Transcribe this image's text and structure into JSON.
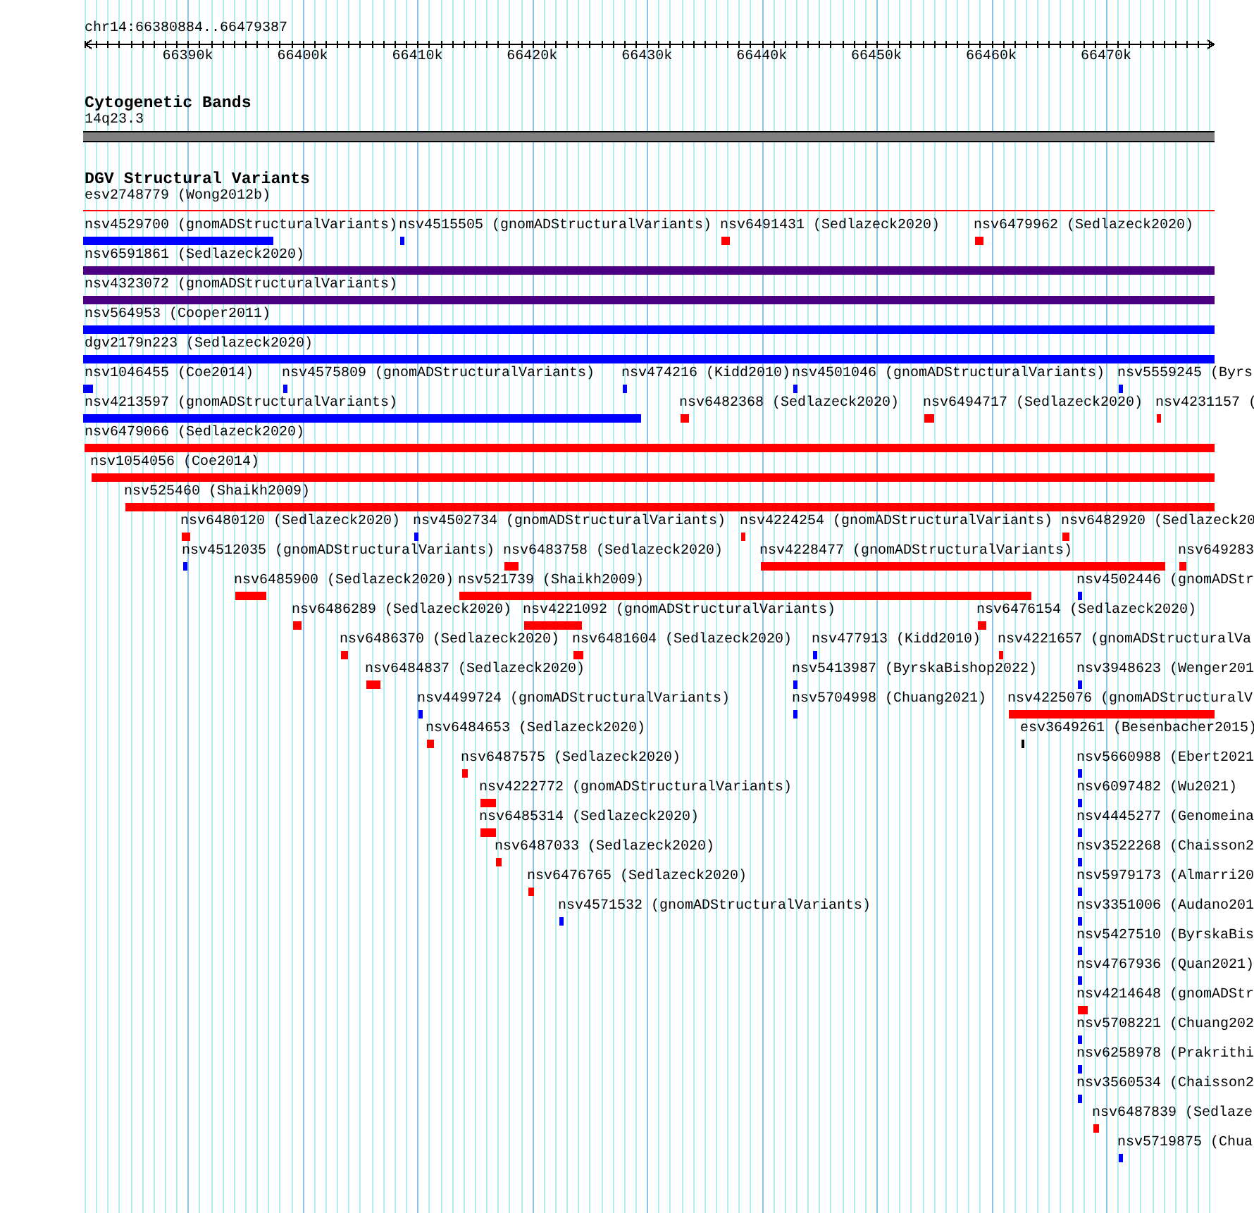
{
  "ruler": {
    "location": "chr14:66380884..66479387",
    "ticks": [
      "66390k",
      "66400k",
      "66410k",
      "66420k",
      "66430k",
      "66440k",
      "66450k",
      "66460k",
      "66470k"
    ]
  },
  "cytogenetic_bands": {
    "title": "Cytogenetic Bands",
    "band_label": "14q23.3"
  },
  "dgv_structural_variants": {
    "title": "DGV Structural Variants",
    "rows": [
      [
        {
          "label": "esv2748779 (Wong2012b)",
          "color": "#ff0000"
        }
      ],
      [
        {
          "label": "nsv4529700 (gnomADStructuralVariants)",
          "color": "#0000ff"
        },
        {
          "label": "nsv4515505 (gnomADStructuralVariants)",
          "color": "#0000ff"
        },
        {
          "label": "nsv6491431 (Sedlazeck2020)",
          "color": "#ff0000"
        },
        {
          "label": "nsv6479962 (Sedlazeck2020)",
          "color": "#ff0000"
        }
      ],
      [
        {
          "label": "nsv6591861 (Sedlazeck2020)",
          "color": "#4b0082"
        }
      ],
      [
        {
          "label": "nsv4323072 (gnomADStructuralVariants)",
          "color": "#4b0082"
        }
      ],
      [
        {
          "label": "nsv564953 (Cooper2011)",
          "color": "#0000ff"
        }
      ],
      [
        {
          "label": "dgv2179n223 (Sedlazeck2020)",
          "color": "#0000ff"
        }
      ],
      [
        {
          "label": "nsv1046455 (Coe2014)",
          "color": "#0000ff"
        },
        {
          "label": "nsv4575809 (gnomADStructuralVariants)",
          "color": "#0000ff"
        },
        {
          "label": "nsv474216 (Kidd2010)",
          "color": "#0000ff"
        },
        {
          "label": "nsv4501046 (gnomADStructuralVariants)",
          "color": "#0000ff"
        },
        {
          "label": "nsv5559245 (Byrs",
          "color": "#0000ff"
        }
      ],
      [
        {
          "label": "nsv4213597 (gnomADStructuralVariants)",
          "color": "#0000ff"
        },
        {
          "label": "nsv6482368 (Sedlazeck2020)",
          "color": "#ff0000"
        },
        {
          "label": "nsv6494717 (Sedlazeck2020)",
          "color": "#ff0000"
        },
        {
          "label": "nsv4231157 (",
          "color": "#ff0000"
        }
      ],
      [
        {
          "label": "nsv6479066 (Sedlazeck2020)",
          "color": "#ff0000"
        }
      ],
      [
        {
          "label": "nsv1054056 (Coe2014)",
          "color": "#ff0000"
        }
      ],
      [
        {
          "label": "nsv525460 (Shaikh2009)",
          "color": "#ff0000"
        }
      ],
      [
        {
          "label": "nsv6480120 (Sedlazeck2020)",
          "color": "#ff0000"
        },
        {
          "label": "nsv4502734 (gnomADStructuralVariants)",
          "color": "#0000ff"
        },
        {
          "label": "nsv4224254 (gnomADStructuralVariants)",
          "color": "#ff0000"
        },
        {
          "label": "nsv6482920 (Sedlazeck20",
          "color": "#ff0000"
        }
      ],
      [
        {
          "label": "nsv4512035 (gnomADStructuralVariants)",
          "color": "#0000ff"
        },
        {
          "label": "nsv6483758 (Sedlazeck2020)",
          "color": "#ff0000"
        },
        {
          "label": "nsv4228477 (gnomADStructuralVariants)",
          "color": "#ff0000"
        },
        {
          "label": "nsv649283",
          "color": "#ff0000"
        }
      ],
      [
        {
          "label": "nsv6485900 (Sedlazeck2020)",
          "color": "#ff0000"
        },
        {
          "label": "nsv521739 (Shaikh2009)",
          "color": "#ff0000"
        },
        {
          "label": "nsv4502446 (gnomADStr",
          "color": "#0000ff"
        }
      ],
      [
        {
          "label": "nsv6486289 (Sedlazeck2020)",
          "color": "#ff0000"
        },
        {
          "label": "nsv4221092 (gnomADStructuralVariants)",
          "color": "#ff0000"
        },
        {
          "label": "nsv6476154 (Sedlazeck2020)",
          "color": "#ff0000"
        }
      ],
      [
        {
          "label": "nsv6486370 (Sedlazeck2020)",
          "color": "#ff0000"
        },
        {
          "label": "nsv6481604 (Sedlazeck2020)",
          "color": "#ff0000"
        },
        {
          "label": "nsv477913 (Kidd2010)",
          "color": "#0000ff"
        },
        {
          "label": "nsv4221657 (gnomADStructuralVa",
          "color": "#ff0000"
        }
      ],
      [
        {
          "label": "nsv6484837 (Sedlazeck2020)",
          "color": "#ff0000"
        },
        {
          "label": "nsv5413987 (ByrskaBishop2022)",
          "color": "#0000ff"
        },
        {
          "label": "nsv3948623 (Wenger201",
          "color": "#0000ff"
        }
      ],
      [
        {
          "label": "nsv4499724 (gnomADStructuralVariants)",
          "color": "#0000ff"
        },
        {
          "label": "nsv5704998 (Chuang2021)",
          "color": "#0000ff"
        },
        {
          "label": "nsv4225076 (gnomADStructuralV",
          "color": "#ff0000"
        }
      ],
      [
        {
          "label": "nsv6484653 (Sedlazeck2020)",
          "color": "#ff0000"
        },
        {
          "label": "esv3649261 (Besenbacher2015)",
          "color": "#000000"
        }
      ],
      [
        {
          "label": "nsv6487575 (Sedlazeck2020)",
          "color": "#ff0000"
        },
        {
          "label": "nsv5660988 (Ebert2021",
          "color": "#0000ff"
        }
      ],
      [
        {
          "label": "nsv4222772 (gnomADStructuralVariants)",
          "color": "#ff0000"
        },
        {
          "label": "nsv6097482 (Wu2021)",
          "color": "#0000ff"
        }
      ],
      [
        {
          "label": "nsv6485314 (Sedlazeck2020)",
          "color": "#ff0000"
        },
        {
          "label": "nsv4445277 (Genomeina",
          "color": "#0000ff"
        }
      ],
      [
        {
          "label": "nsv6487033 (Sedlazeck2020)",
          "color": "#ff0000"
        },
        {
          "label": "nsv3522268 (Chaisson2",
          "color": "#0000ff"
        }
      ],
      [
        {
          "label": "nsv6476765 (Sedlazeck2020)",
          "color": "#ff0000"
        },
        {
          "label": "nsv5979173 (Almarri20",
          "color": "#0000ff"
        }
      ],
      [
        {
          "label": "nsv4571532 (gnomADStructuralVariants)",
          "color": "#0000ff"
        },
        {
          "label": "nsv3351006 (Audano201",
          "color": "#0000ff"
        }
      ],
      [
        {
          "label": "nsv5427510 (ByrskaBis",
          "color": "#0000ff"
        }
      ],
      [
        {
          "label": "nsv4767936 (Quan2021)",
          "color": "#0000ff"
        }
      ],
      [
        {
          "label": "nsv4214648 (gnomADStr",
          "color": "#ff0000"
        }
      ],
      [
        {
          "label": "nsv5708221 (Chuang202",
          "color": "#0000ff"
        }
      ],
      [
        {
          "label": "nsv6258978 (Prakrithi",
          "color": "#0000ff"
        }
      ],
      [
        {
          "label": "nsv3560534 (Chaisson2",
          "color": "#0000ff"
        }
      ],
      [
        {
          "label": "nsv6487839 (Sedlaze",
          "color": "#ff0000"
        }
      ],
      [
        {
          "label": "nsv5719875 (Chua",
          "color": "#0000ff"
        }
      ]
    ]
  }
}
